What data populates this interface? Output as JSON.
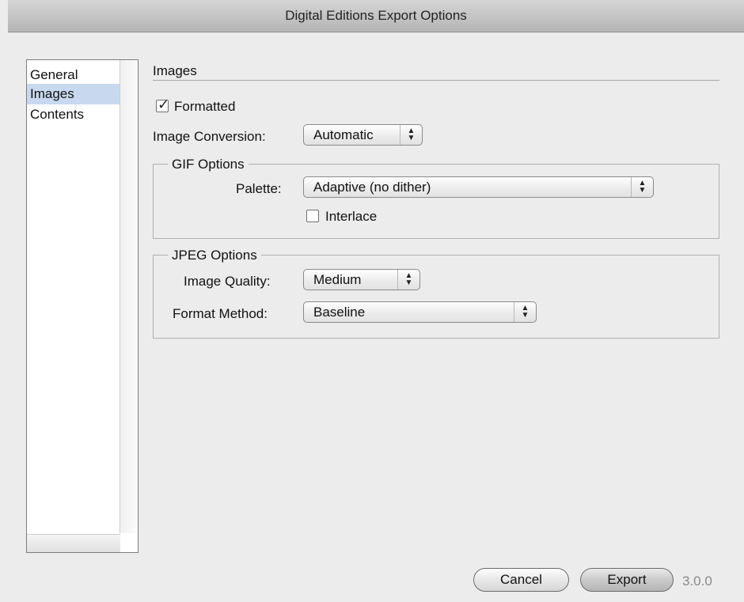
{
  "window": {
    "title": "Digital Editions Export Options"
  },
  "sidebar": {
    "items": [
      {
        "label": "General",
        "selected": false
      },
      {
        "label": "Images",
        "selected": true
      },
      {
        "label": "Contents",
        "selected": false
      }
    ]
  },
  "images": {
    "section_title": "Images",
    "formatted_label": "Formatted",
    "formatted_checked": true,
    "image_conversion_label": "Image Conversion:",
    "image_conversion_value": "Automatic",
    "gif": {
      "legend": "GIF Options",
      "palette_label": "Palette:",
      "palette_value": "Adaptive (no dither)",
      "interlace_label": "Interlace",
      "interlace_checked": false
    },
    "jpeg": {
      "legend": "JPEG Options",
      "quality_label": "Image Quality:",
      "quality_value": "Medium",
      "method_label": "Format Method:",
      "method_value": "Baseline"
    }
  },
  "footer": {
    "cancel_label": "Cancel",
    "export_label": "Export",
    "version": "3.0.0"
  },
  "icons": {
    "checkmark": "✓",
    "updown": "▲▼"
  }
}
